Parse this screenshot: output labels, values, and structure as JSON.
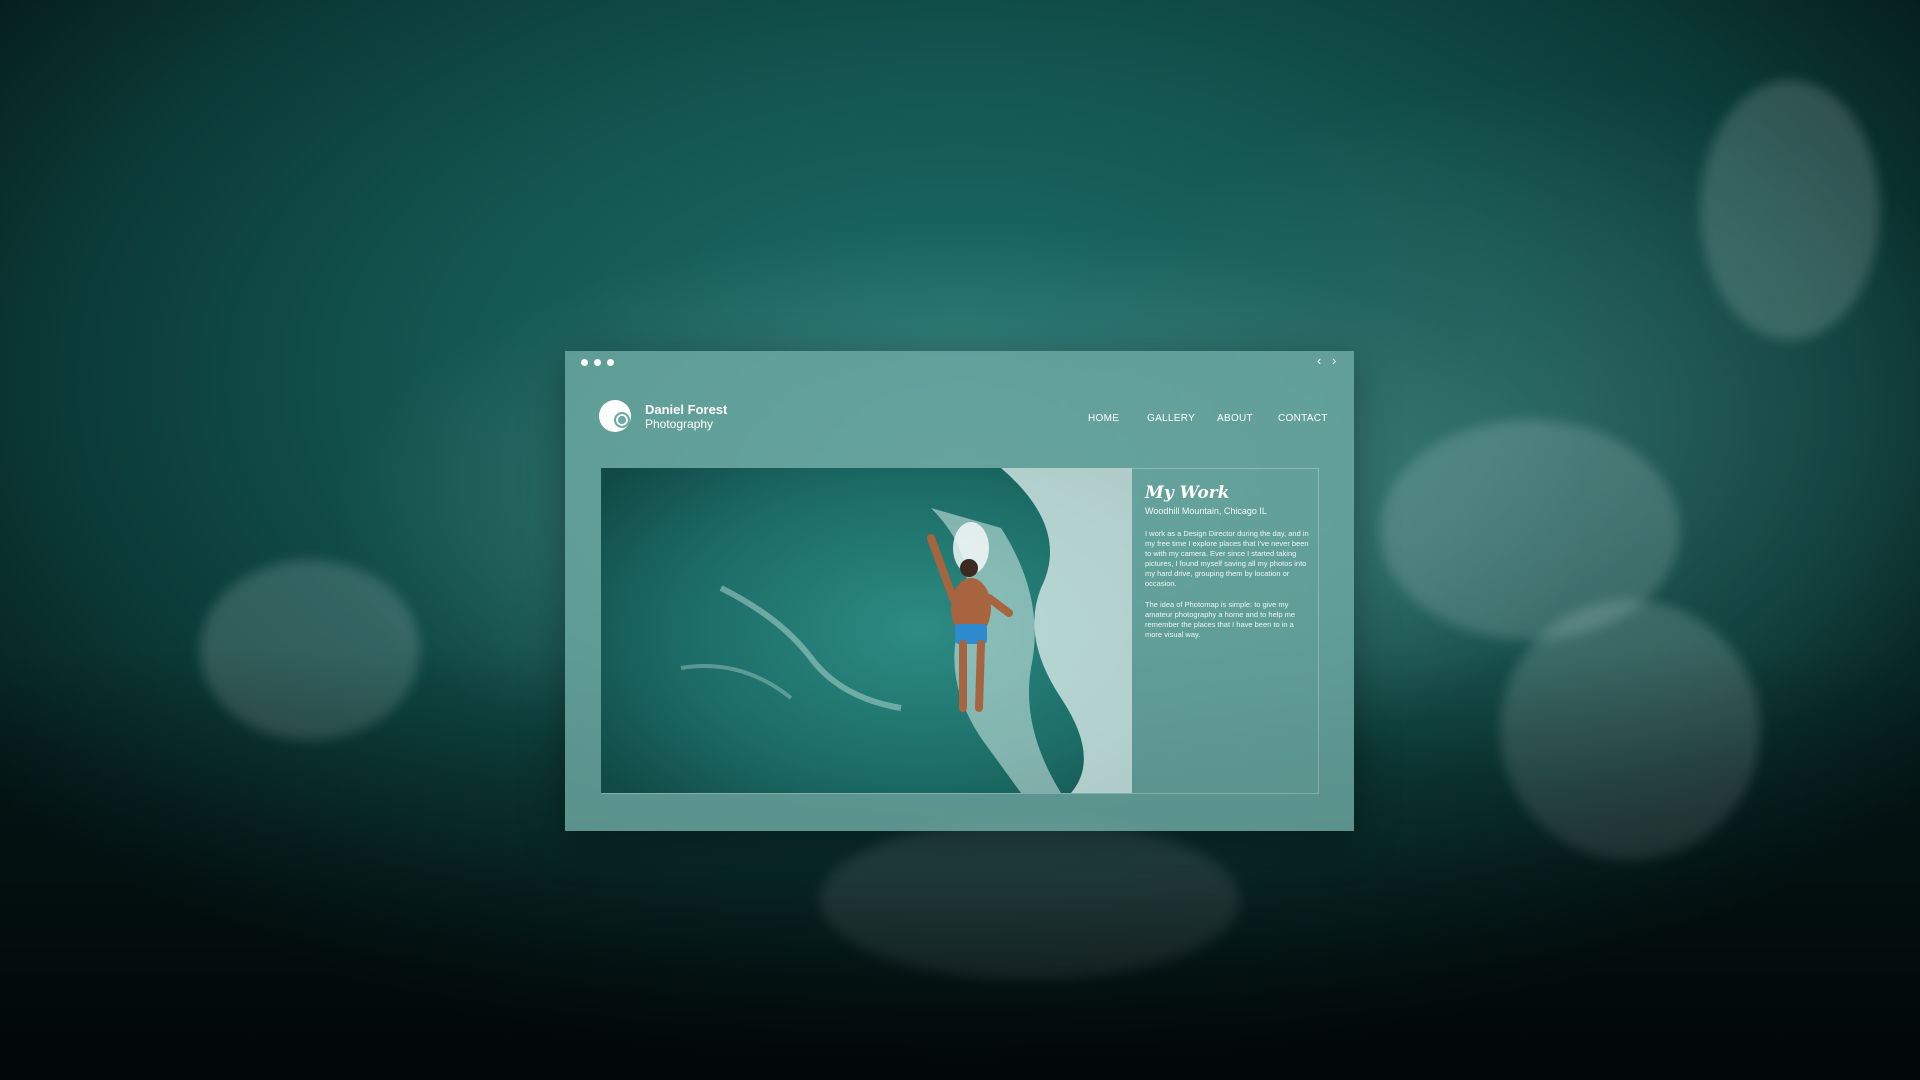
{
  "window": {
    "controls": {
      "dots": 3,
      "back_icon": "chevron-left-icon",
      "forward_icon": "chevron-right-icon"
    }
  },
  "site": {
    "brand": {
      "name": "Daniel Forest",
      "subtitle": "Photography",
      "logo_icon": "camera-logo-icon"
    },
    "nav": [
      {
        "label": "HOME"
      },
      {
        "label": "GALLERY"
      },
      {
        "label": "ABOUT"
      },
      {
        "label": "CONTACT"
      }
    ]
  },
  "content": {
    "title": "My Work",
    "location": "Woodhill Mountain, Chicago IL",
    "paragraphs": [
      "I work as a Design Director during the day, and in my free time I explore places that I've never been to with my camera. Ever since I started taking pictures, I found myself saving all my photos into my hard drive, grouping them by location or occasion.",
      "The idea of Photomap is simple: to give my amateur photography a home and to help me remember the places that I have been to in a more visual way."
    ]
  },
  "colors": {
    "window_tint": "#6eaaa4",
    "ocean_deep": "#0b3a37",
    "ocean_mid": "#1e6f69",
    "text": "#ffffff"
  }
}
